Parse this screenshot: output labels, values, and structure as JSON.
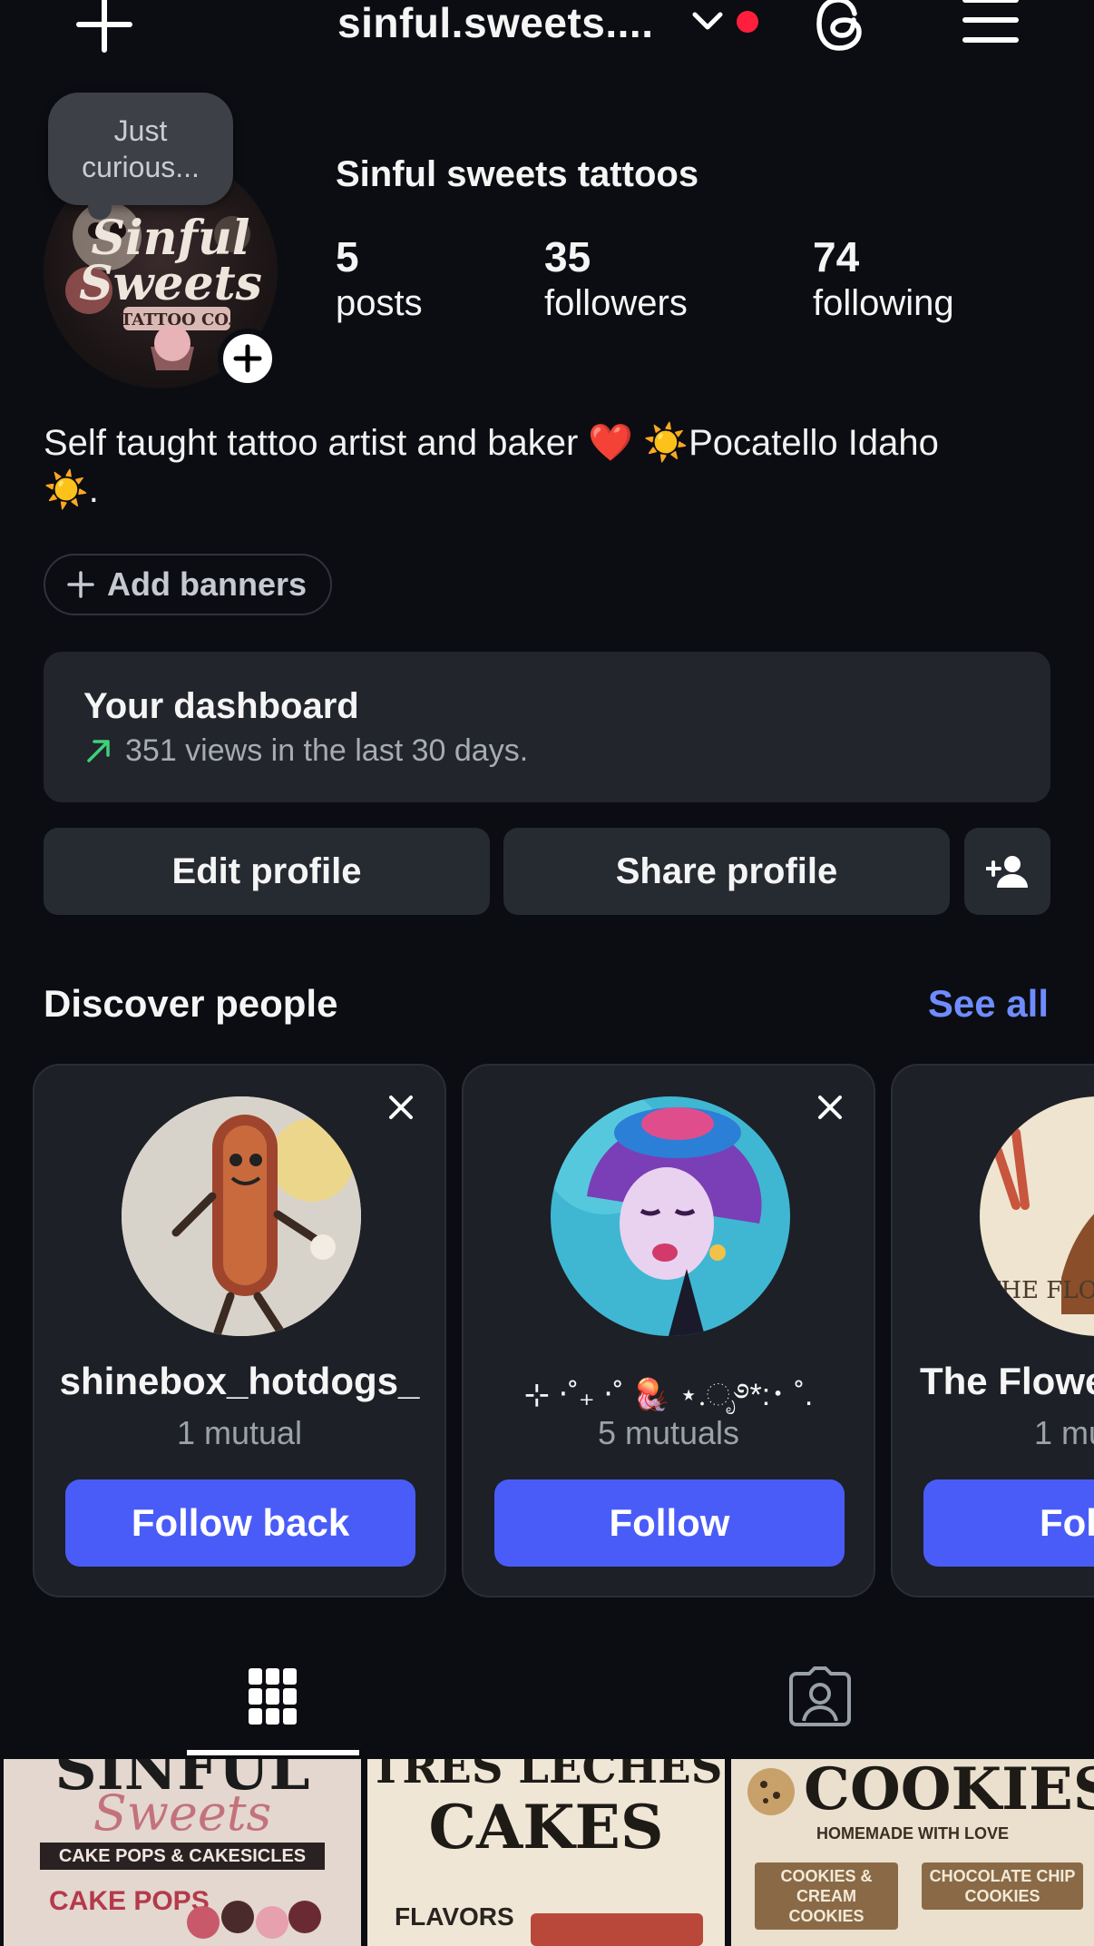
{
  "topbar": {
    "username": "sinful.sweets....",
    "icons": [
      "create-plus-icon",
      "chevron-down-icon",
      "threads-icon",
      "menu-icon"
    ]
  },
  "profile": {
    "note": "Just curious...",
    "display_name": "Sinful sweets tattoos",
    "stats": [
      {
        "value": "5",
        "label": "posts"
      },
      {
        "value": "35",
        "label": "followers"
      },
      {
        "value": "74",
        "label": "following"
      }
    ],
    "bio_line1": "Self taught tattoo artist and baker ❤️ ☀️Pocatello Idaho",
    "bio_line2": "☀️.",
    "add_banners": "Add banners"
  },
  "dashboard": {
    "title": "Your dashboard",
    "subtitle": "351 views in the last 30 days."
  },
  "actions": {
    "edit": "Edit profile",
    "share": "Share profile"
  },
  "discover": {
    "title": "Discover people",
    "see_all": "See all",
    "cards": [
      {
        "name": "shinebox_hotdogs_",
        "mutual": "1 mutual",
        "button": "Follow back"
      },
      {
        "name": "⊹ ‧˚₊ ‧˚ 🪼 ⋆.ೃ࿔*:･ ˚.",
        "mutual": "5 mutuals",
        "button": "Follow"
      },
      {
        "name": "The Flowe",
        "mutual": "1 mu",
        "button": "Fol"
      }
    ]
  },
  "grid": {
    "thumbs": [
      {
        "title": "SINFUL",
        "sub": "Sweets",
        "line": "CAKE POPS & CAKESICLES",
        "item": "CAKE POPS"
      },
      {
        "title": "TRES LECHES",
        "sub": "CAKES",
        "line": "",
        "item": "FLAVORS"
      },
      {
        "title": "COOKIES",
        "sub": "HOMEMADE WITH LOVE",
        "line": "COOKIES & CREAM COOKIES",
        "item": "CHOCOLATE CHIP COOKIES"
      }
    ]
  },
  "colors": {
    "background": "#0b0d12",
    "accent": "#4a5cf7",
    "link": "#6f8cff",
    "notify": "#ff1f3d",
    "trend": "#3fd07b"
  }
}
